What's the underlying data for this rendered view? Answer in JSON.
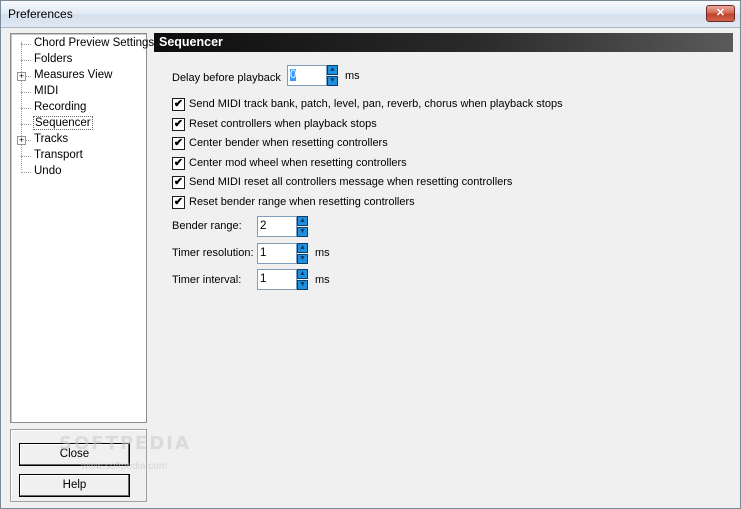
{
  "window": {
    "title": "Preferences",
    "close_glyph": "✕"
  },
  "tree": {
    "items": [
      {
        "label": "Chord Preview Settings",
        "expandable": false
      },
      {
        "label": "Folders",
        "expandable": false
      },
      {
        "label": "Measures View",
        "expandable": true
      },
      {
        "label": "MIDI",
        "expandable": false
      },
      {
        "label": "Recording",
        "expandable": false
      },
      {
        "label": "Sequencer",
        "expandable": false,
        "selected": true
      },
      {
        "label": "Tracks",
        "expandable": true
      },
      {
        "label": "Transport",
        "expandable": false
      },
      {
        "label": "Undo",
        "expandable": false
      }
    ]
  },
  "buttons": {
    "close": "Close",
    "help": "Help"
  },
  "watermark": {
    "text": "SOFTPEDIA",
    "url": "www.softpedia.com"
  },
  "section": {
    "title": "Sequencer"
  },
  "delay": {
    "label": "Delay before playback",
    "value": "0",
    "unit": "ms"
  },
  "checkboxes": [
    {
      "label": "Send MIDI track bank, patch, level, pan, reverb, chorus when playback stops",
      "checked": true
    },
    {
      "label": "Reset controllers when playback stops",
      "checked": true
    },
    {
      "label": "Center bender when resetting controllers",
      "checked": true
    },
    {
      "label": "Center mod wheel when resetting controllers",
      "checked": true
    },
    {
      "label": "Send MIDI reset all controllers message when resetting controllers",
      "checked": true
    },
    {
      "label": "Reset bender range when resetting controllers",
      "checked": true
    }
  ],
  "check_glyph": "✔",
  "bender_range": {
    "label": "Bender range:",
    "value": "2"
  },
  "timer_resolution": {
    "label": "Timer resolution:",
    "value": "1",
    "unit": "ms"
  },
  "timer_interval": {
    "label": "Timer interval:",
    "value": "1",
    "unit": "ms"
  },
  "spin_glyphs": {
    "up": "▲",
    "down": "▼"
  },
  "colors": {
    "header_bg": "#1a1a1a",
    "spin_accent": "#1f8fe0",
    "close_red": "#c0432b"
  }
}
